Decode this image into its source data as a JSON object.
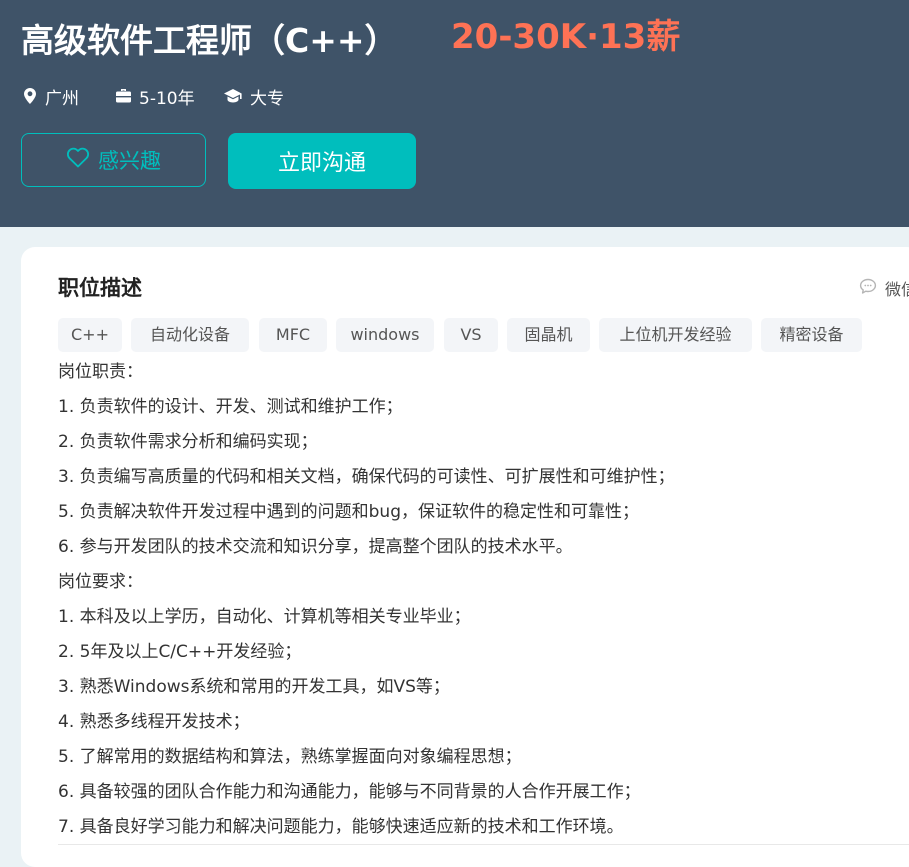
{
  "header": {
    "title": "高级软件工程师（C++）",
    "salary": "20-30K·13薪",
    "city": "广州",
    "experience": "5-10年",
    "degree": "大专",
    "interest_label": "感兴趣",
    "chat_label": "立即沟通"
  },
  "description": {
    "section_title": "职位描述",
    "share_label": "微信",
    "tags": [
      "C++",
      "自动化设备",
      "MFC",
      "windows",
      "VS",
      "固晶机",
      "上位机开发经验",
      "精密设备"
    ],
    "lines": [
      "岗位职责：",
      "1. 负责软件的设计、开发、测试和维护工作；",
      "2. 负责软件需求分析和编码实现；",
      "3. 负责编写高质量的代码和相关文档，确保代码的可读性、可扩展性和可维护性；",
      "5. 负责解决软件开发过程中遇到的问题和bug，保证软件的稳定性和可靠性；",
      "6. 参与开发团队的技术交流和知识分享，提高整个团队的技术水平。",
      "岗位要求：",
      "1. 本科及以上学历，自动化、计算机等相关专业毕业；",
      "2. 5年及以上C/C++开发经验；",
      "3. 熟悉Windows系统和常用的开发工具，如VS等；",
      "4. 熟悉多线程开发技术；",
      "5. 了解常用的数据结构和算法，熟练掌握面向对象编程思想；",
      "6. 具备较强的团队合作能力和沟通能力，能够与不同背景的人合作开展工作；",
      "7. 具备良好学习能力和解决问题能力，能够快速适应新的技术和工作环境。"
    ]
  },
  "icons": [
    "location-icon",
    "briefcase-icon",
    "graduation-cap-icon",
    "heart-icon",
    "chat-bubble-icon"
  ],
  "colors": {
    "header_bg": "#3f5368",
    "salary": "#fe7255",
    "accent": "#00bebd",
    "page_bg": "#eaf2f5"
  }
}
